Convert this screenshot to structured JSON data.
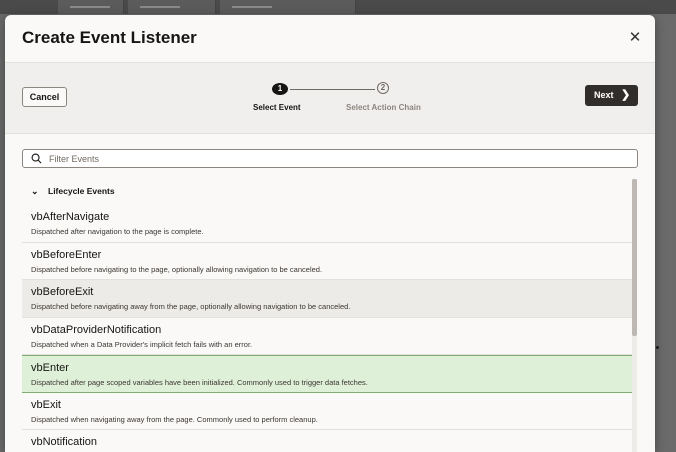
{
  "dialog": {
    "title": "Create Event Listener",
    "close_icon": "close-icon"
  },
  "wizard": {
    "cancel_label": "Cancel",
    "next_label": "Next",
    "steps": [
      {
        "number": "1",
        "label": "Select Event",
        "state": "current"
      },
      {
        "number": "2",
        "label": "Select Action Chain",
        "state": "upcoming"
      }
    ]
  },
  "filter": {
    "placeholder": "Filter Events",
    "value": ""
  },
  "group": {
    "label": "Lifecycle Events",
    "expanded": true
  },
  "events": [
    {
      "name": "vbAfterNavigate",
      "description": "Dispatched after navigation to the page is complete."
    },
    {
      "name": "vbBeforeEnter",
      "description": "Dispatched before navigating to the page, optionally allowing navigation to be canceled."
    },
    {
      "name": "vbBeforeExit",
      "description": "Dispatched before navigating away from the page, optionally allowing navigation to be canceled."
    },
    {
      "name": "vbDataProviderNotification",
      "description": "Dispatched when a Data Provider's implicit fetch fails with an error."
    },
    {
      "name": "vbEnter",
      "description": "Dispatched after page scoped variables have been initialized. Commonly used to trigger data fetches."
    },
    {
      "name": "vbExit",
      "description": "Dispatched when navigating away from the page. Commonly used to perform cleanup."
    },
    {
      "name": "vbNotification",
      "description": ""
    }
  ],
  "colors": {
    "primary_button": "#312d2a",
    "selected_row": "#dff0d8",
    "selected_border": "#7fae73"
  }
}
